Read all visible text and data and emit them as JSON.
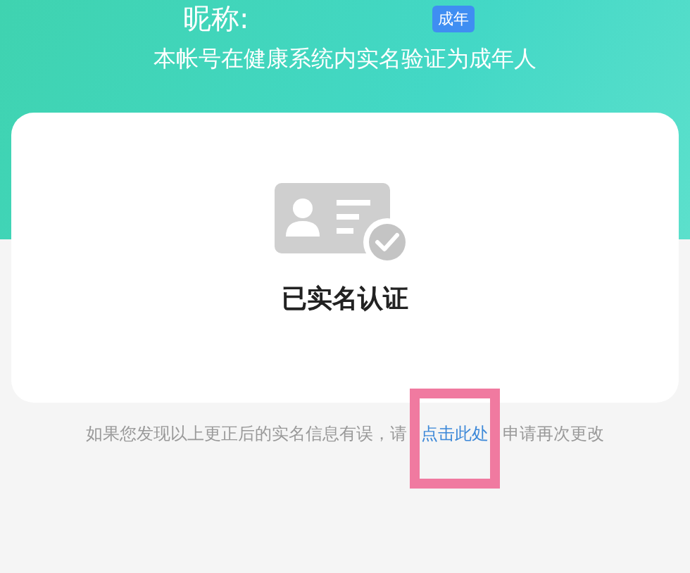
{
  "header": {
    "nickname_label": "昵称:",
    "badge": "成年",
    "subtitle": "本帐号在健康系统内实名验证为成年人"
  },
  "card": {
    "status": "已实名认证"
  },
  "footer": {
    "text_before": "如果您发现以上更正后的实名信息有误，请",
    "link": "点击此处",
    "text_after": "申请再次更改",
    "highlighted": true
  }
}
